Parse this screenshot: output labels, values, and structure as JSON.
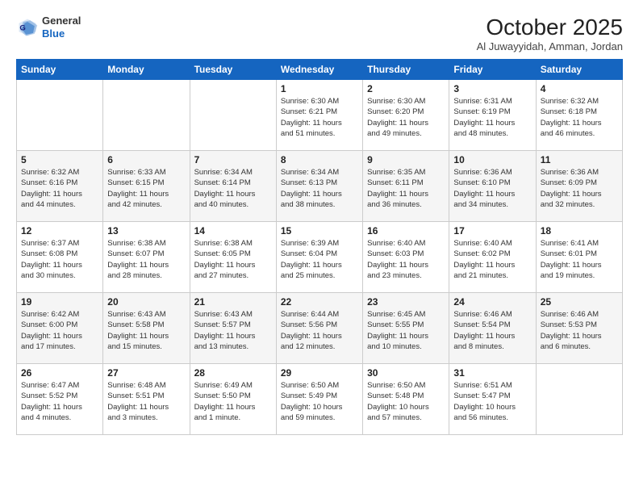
{
  "header": {
    "logo_line1": "General",
    "logo_line2": "Blue",
    "month": "October 2025",
    "location": "Al Juwayyidah, Amman, Jordan"
  },
  "weekdays": [
    "Sunday",
    "Monday",
    "Tuesday",
    "Wednesday",
    "Thursday",
    "Friday",
    "Saturday"
  ],
  "weeks": [
    [
      {
        "day": "",
        "info": ""
      },
      {
        "day": "",
        "info": ""
      },
      {
        "day": "",
        "info": ""
      },
      {
        "day": "1",
        "info": "Sunrise: 6:30 AM\nSunset: 6:21 PM\nDaylight: 11 hours\nand 51 minutes."
      },
      {
        "day": "2",
        "info": "Sunrise: 6:30 AM\nSunset: 6:20 PM\nDaylight: 11 hours\nand 49 minutes."
      },
      {
        "day": "3",
        "info": "Sunrise: 6:31 AM\nSunset: 6:19 PM\nDaylight: 11 hours\nand 48 minutes."
      },
      {
        "day": "4",
        "info": "Sunrise: 6:32 AM\nSunset: 6:18 PM\nDaylight: 11 hours\nand 46 minutes."
      }
    ],
    [
      {
        "day": "5",
        "info": "Sunrise: 6:32 AM\nSunset: 6:16 PM\nDaylight: 11 hours\nand 44 minutes."
      },
      {
        "day": "6",
        "info": "Sunrise: 6:33 AM\nSunset: 6:15 PM\nDaylight: 11 hours\nand 42 minutes."
      },
      {
        "day": "7",
        "info": "Sunrise: 6:34 AM\nSunset: 6:14 PM\nDaylight: 11 hours\nand 40 minutes."
      },
      {
        "day": "8",
        "info": "Sunrise: 6:34 AM\nSunset: 6:13 PM\nDaylight: 11 hours\nand 38 minutes."
      },
      {
        "day": "9",
        "info": "Sunrise: 6:35 AM\nSunset: 6:11 PM\nDaylight: 11 hours\nand 36 minutes."
      },
      {
        "day": "10",
        "info": "Sunrise: 6:36 AM\nSunset: 6:10 PM\nDaylight: 11 hours\nand 34 minutes."
      },
      {
        "day": "11",
        "info": "Sunrise: 6:36 AM\nSunset: 6:09 PM\nDaylight: 11 hours\nand 32 minutes."
      }
    ],
    [
      {
        "day": "12",
        "info": "Sunrise: 6:37 AM\nSunset: 6:08 PM\nDaylight: 11 hours\nand 30 minutes."
      },
      {
        "day": "13",
        "info": "Sunrise: 6:38 AM\nSunset: 6:07 PM\nDaylight: 11 hours\nand 28 minutes."
      },
      {
        "day": "14",
        "info": "Sunrise: 6:38 AM\nSunset: 6:05 PM\nDaylight: 11 hours\nand 27 minutes."
      },
      {
        "day": "15",
        "info": "Sunrise: 6:39 AM\nSunset: 6:04 PM\nDaylight: 11 hours\nand 25 minutes."
      },
      {
        "day": "16",
        "info": "Sunrise: 6:40 AM\nSunset: 6:03 PM\nDaylight: 11 hours\nand 23 minutes."
      },
      {
        "day": "17",
        "info": "Sunrise: 6:40 AM\nSunset: 6:02 PM\nDaylight: 11 hours\nand 21 minutes."
      },
      {
        "day": "18",
        "info": "Sunrise: 6:41 AM\nSunset: 6:01 PM\nDaylight: 11 hours\nand 19 minutes."
      }
    ],
    [
      {
        "day": "19",
        "info": "Sunrise: 6:42 AM\nSunset: 6:00 PM\nDaylight: 11 hours\nand 17 minutes."
      },
      {
        "day": "20",
        "info": "Sunrise: 6:43 AM\nSunset: 5:58 PM\nDaylight: 11 hours\nand 15 minutes."
      },
      {
        "day": "21",
        "info": "Sunrise: 6:43 AM\nSunset: 5:57 PM\nDaylight: 11 hours\nand 13 minutes."
      },
      {
        "day": "22",
        "info": "Sunrise: 6:44 AM\nSunset: 5:56 PM\nDaylight: 11 hours\nand 12 minutes."
      },
      {
        "day": "23",
        "info": "Sunrise: 6:45 AM\nSunset: 5:55 PM\nDaylight: 11 hours\nand 10 minutes."
      },
      {
        "day": "24",
        "info": "Sunrise: 6:46 AM\nSunset: 5:54 PM\nDaylight: 11 hours\nand 8 minutes."
      },
      {
        "day": "25",
        "info": "Sunrise: 6:46 AM\nSunset: 5:53 PM\nDaylight: 11 hours\nand 6 minutes."
      }
    ],
    [
      {
        "day": "26",
        "info": "Sunrise: 6:47 AM\nSunset: 5:52 PM\nDaylight: 11 hours\nand 4 minutes."
      },
      {
        "day": "27",
        "info": "Sunrise: 6:48 AM\nSunset: 5:51 PM\nDaylight: 11 hours\nand 3 minutes."
      },
      {
        "day": "28",
        "info": "Sunrise: 6:49 AM\nSunset: 5:50 PM\nDaylight: 11 hours\nand 1 minute."
      },
      {
        "day": "29",
        "info": "Sunrise: 6:50 AM\nSunset: 5:49 PM\nDaylight: 10 hours\nand 59 minutes."
      },
      {
        "day": "30",
        "info": "Sunrise: 6:50 AM\nSunset: 5:48 PM\nDaylight: 10 hours\nand 57 minutes."
      },
      {
        "day": "31",
        "info": "Sunrise: 6:51 AM\nSunset: 5:47 PM\nDaylight: 10 hours\nand 56 minutes."
      },
      {
        "day": "",
        "info": ""
      }
    ]
  ]
}
